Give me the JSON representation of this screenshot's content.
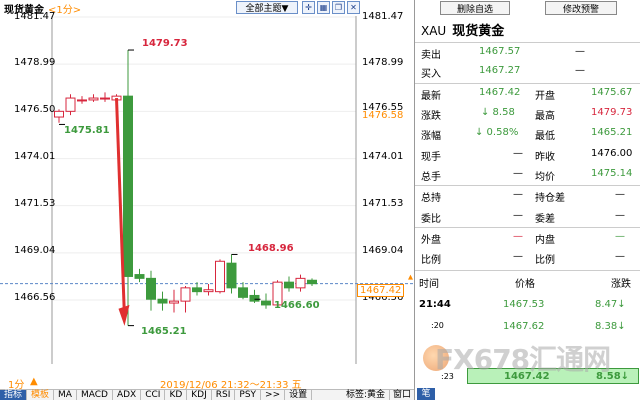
{
  "chart_header": {
    "title": "现货黄金",
    "period": "<1分>",
    "theme_button": "全部主题▼"
  },
  "chart_data": {
    "type": "candlestick",
    "ylim": [
      1465.2,
      1481.8
    ],
    "y_ticks_left": [
      "1481.47",
      "1478.99",
      "1476.50",
      "1474.01",
      "1471.53",
      "1469.04",
      "1466.56"
    ],
    "y_ticks_right": [
      "1481.47",
      "1478.99",
      "1476.55",
      "1476.58",
      "1474.01",
      "1471.53",
      "1469.04",
      "1466.56"
    ],
    "current_price": "1467.42",
    "candles": [
      {
        "o": 1476.2,
        "h": 1476.6,
        "l": 1475.9,
        "c": 1476.5
      },
      {
        "o": 1476.5,
        "h": 1477.4,
        "l": 1476.3,
        "c": 1477.2
      },
      {
        "o": 1477.1,
        "h": 1477.3,
        "l": 1476.9,
        "c": 1477.1
      },
      {
        "o": 1477.1,
        "h": 1477.4,
        "l": 1477.0,
        "c": 1477.2
      },
      {
        "o": 1477.2,
        "h": 1477.5,
        "l": 1477.0,
        "c": 1477.2
      },
      {
        "o": 1477.1,
        "h": 1477.4,
        "l": 1476.9,
        "c": 1477.3
      },
      {
        "o": 1477.3,
        "h": 1479.73,
        "l": 1465.21,
        "c": 1467.8
      },
      {
        "o": 1467.9,
        "h": 1468.2,
        "l": 1467.5,
        "c": 1467.7
      },
      {
        "o": 1467.7,
        "h": 1468.1,
        "l": 1466.0,
        "c": 1466.6
      },
      {
        "o": 1466.6,
        "h": 1467.0,
        "l": 1466.0,
        "c": 1466.4
      },
      {
        "o": 1466.4,
        "h": 1467.1,
        "l": 1465.9,
        "c": 1466.5
      },
      {
        "o": 1466.5,
        "h": 1467.3,
        "l": 1465.9,
        "c": 1467.2
      },
      {
        "o": 1467.2,
        "h": 1467.5,
        "l": 1466.8,
        "c": 1467.0
      },
      {
        "o": 1467.0,
        "h": 1467.4,
        "l": 1466.8,
        "c": 1467.1
      },
      {
        "o": 1467.0,
        "h": 1468.7,
        "l": 1466.9,
        "c": 1468.6
      },
      {
        "o": 1468.5,
        "h": 1468.96,
        "l": 1466.9,
        "c": 1467.2
      },
      {
        "o": 1467.2,
        "h": 1467.5,
        "l": 1466.6,
        "c": 1466.7
      },
      {
        "o": 1466.8,
        "h": 1467.1,
        "l": 1466.4,
        "c": 1466.5
      },
      {
        "o": 1466.5,
        "h": 1466.9,
        "l": 1466.1,
        "c": 1466.3
      },
      {
        "o": 1466.3,
        "h": 1467.6,
        "l": 1466.2,
        "c": 1467.5
      },
      {
        "o": 1467.5,
        "h": 1467.8,
        "l": 1467.0,
        "c": 1467.2
      },
      {
        "o": 1467.2,
        "h": 1467.9,
        "l": 1467.0,
        "c": 1467.7
      },
      {
        "o": 1467.6,
        "h": 1467.7,
        "l": 1467.3,
        "c": 1467.42
      }
    ],
    "annotations": [
      {
        "text": "1479.73",
        "value": 1479.73,
        "candle": 6,
        "color": "red"
      },
      {
        "text": "1475.81",
        "value": 1475.81,
        "candle": 0,
        "color": "green"
      },
      {
        "text": "1465.21",
        "value": 1465.21,
        "candle": 6,
        "color": "green"
      },
      {
        "text": "1468.96",
        "value": 1468.96,
        "candle": 15,
        "color": "red"
      },
      {
        "text": "1466.60",
        "value": 1466.6,
        "candle": 17,
        "color": "green"
      }
    ],
    "colors": {
      "up": "#d7263d",
      "down": "#3d9a3d",
      "arrow": "#e03030",
      "price_line": "#5a86c8"
    }
  },
  "bottom_bar": {
    "period": "1分",
    "datetime_range": "2019/12/06 21:32～21:33 五",
    "tabs": [
      "指标",
      "模板",
      "MA",
      "MACD",
      "ADX",
      "CCI",
      "KD",
      "KDJ",
      "RSI",
      "PSY",
      ">>",
      "设置"
    ],
    "tag_label": "标签:黄金",
    "window_button": "窗口"
  },
  "panel": {
    "delete_button": "删除自选",
    "alert_button": "修改预警",
    "code": "XAU",
    "name": "现货黄金",
    "sell_label": "卖出",
    "sell_value": "1467.57",
    "sell_extra": "—",
    "buy_label": "买入",
    "buy_value": "1467.27",
    "buy_extra": "—",
    "latest_label": "最新",
    "latest_value": "1467.42",
    "open_label": "开盘",
    "open_value": "1475.67",
    "change_label": "涨跌",
    "change_value": "↓ 8.58",
    "high_label": "最高",
    "high_value": "1479.73",
    "changepct_label": "涨幅",
    "changepct_value": "↓ 0.58%",
    "low_label": "最低",
    "low_value": "1465.21",
    "hand_label": "现手",
    "hand_value": "—",
    "prevclose_label": "昨收",
    "prevclose_value": "1476.00",
    "totalhand_label": "总手",
    "totalhand_value": "—",
    "avg_label": "均价",
    "avg_value": "1475.14",
    "hold_label": "总持",
    "hold_value": "—",
    "holddiff_label": "持仓差",
    "holddiff_value": "—",
    "bidratio_label": "委比",
    "bidratio_value": "—",
    "biddiff_label": "委差",
    "biddiff_value": "—",
    "outer_label": "外盘",
    "outer_value": "—",
    "inner_label": "内盘",
    "inner_value": "—",
    "ratio1_label": "比例",
    "ratio1_value": "—",
    "ratio2_label": "比例",
    "ratio2_value": "—",
    "ticks_header": {
      "time": "时间",
      "price": "价格",
      "change": "涨跌"
    },
    "ticks": [
      {
        "time": "21:44",
        "price": "1467.53",
        "change": "8.47↓"
      },
      {
        "time": ":20",
        "price": "1467.62",
        "change": "8.38↓"
      },
      {
        "time": ":23",
        "price": "1467.42",
        "change": "8.58↓"
      }
    ],
    "bottom_tab": "笔"
  },
  "watermark": "FX678汇通网"
}
